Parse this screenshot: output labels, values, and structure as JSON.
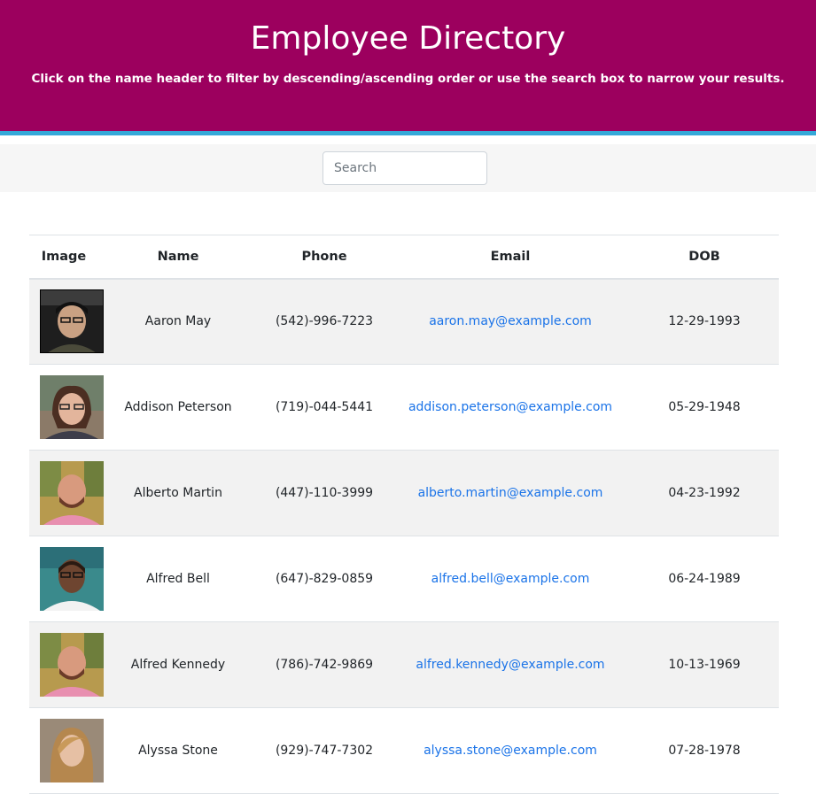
{
  "header": {
    "title": "Employee Directory",
    "subtitle": "Click on the name header to filter by descending/ascending order or use the search box to narrow your results.",
    "background_color": "#9c005e",
    "accent_color": "#34a8d8"
  },
  "search": {
    "placeholder": "Search",
    "value": ""
  },
  "table": {
    "columns": [
      "Image",
      "Name",
      "Phone",
      "Email",
      "DOB"
    ],
    "rows": [
      {
        "name": "Aaron May",
        "phone": "(542)-996-7223",
        "email": "aaron.may@example.com",
        "dob": "12-29-1993",
        "photo": "avatar-photo"
      },
      {
        "name": "Addison Peterson",
        "phone": "(719)-044-5441",
        "email": "addison.peterson@example.com",
        "dob": "05-29-1948",
        "photo": "avatar-photo"
      },
      {
        "name": "Alberto Martin",
        "phone": "(447)-110-3999",
        "email": "alberto.martin@example.com",
        "dob": "04-23-1992",
        "photo": "avatar-photo"
      },
      {
        "name": "Alfred Bell",
        "phone": "(647)-829-0859",
        "email": "alfred.bell@example.com",
        "dob": "06-24-1989",
        "photo": "avatar-photo"
      },
      {
        "name": "Alfred Kennedy",
        "phone": "(786)-742-9869",
        "email": "alfred.kennedy@example.com",
        "dob": "10-13-1969",
        "photo": "avatar-photo"
      },
      {
        "name": "Alyssa Stone",
        "phone": "(929)-747-7302",
        "email": "alyssa.stone@example.com",
        "dob": "07-28-1978",
        "photo": "avatar-photo"
      }
    ],
    "link_color": "#1a73e8",
    "stripe_color": "#f2f2f2"
  }
}
